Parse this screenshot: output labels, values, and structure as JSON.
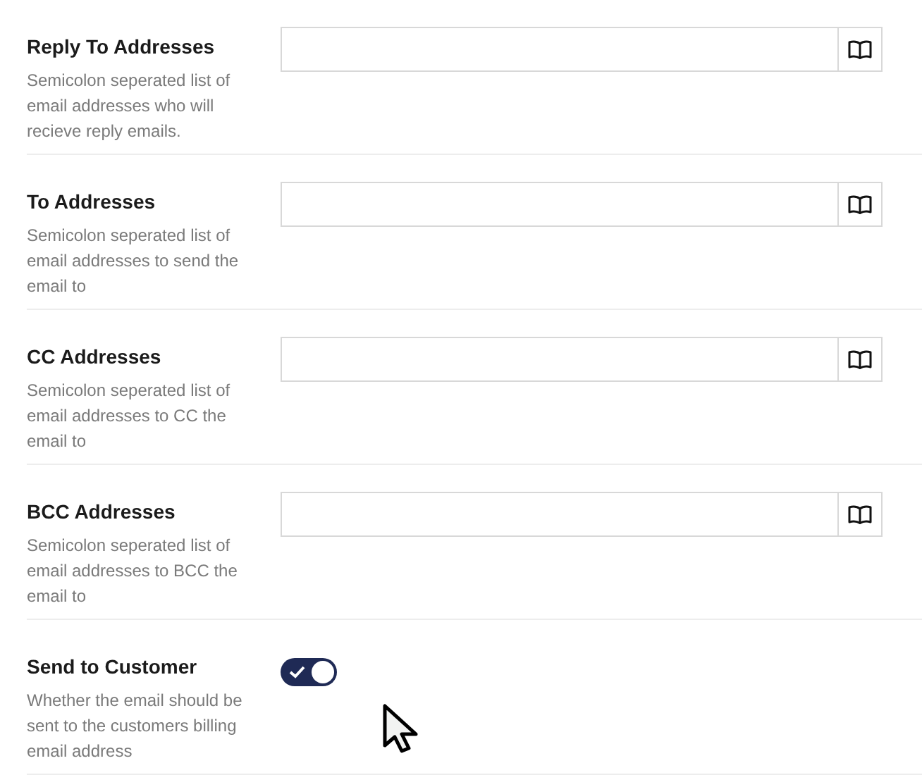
{
  "fields": [
    {
      "kind": "address",
      "label": "Reply To Addresses",
      "description": "Semicolon seperated list of email addresses who will recieve reply emails."
    },
    {
      "kind": "address",
      "label": "To Addresses",
      "description": "Semicolon seperated list of email addresses to send the email to"
    },
    {
      "kind": "address",
      "label": "CC Addresses",
      "description": "Semicolon seperated list of email addresses to CC the email to"
    },
    {
      "kind": "address",
      "label": "BCC Addresses",
      "description": "Semicolon seperated list of email addresses to BCC the email to"
    },
    {
      "kind": "toggle",
      "label": "Send to Customer",
      "description": "Whether the email should be sent to the customers billing email address",
      "on": true
    }
  ]
}
